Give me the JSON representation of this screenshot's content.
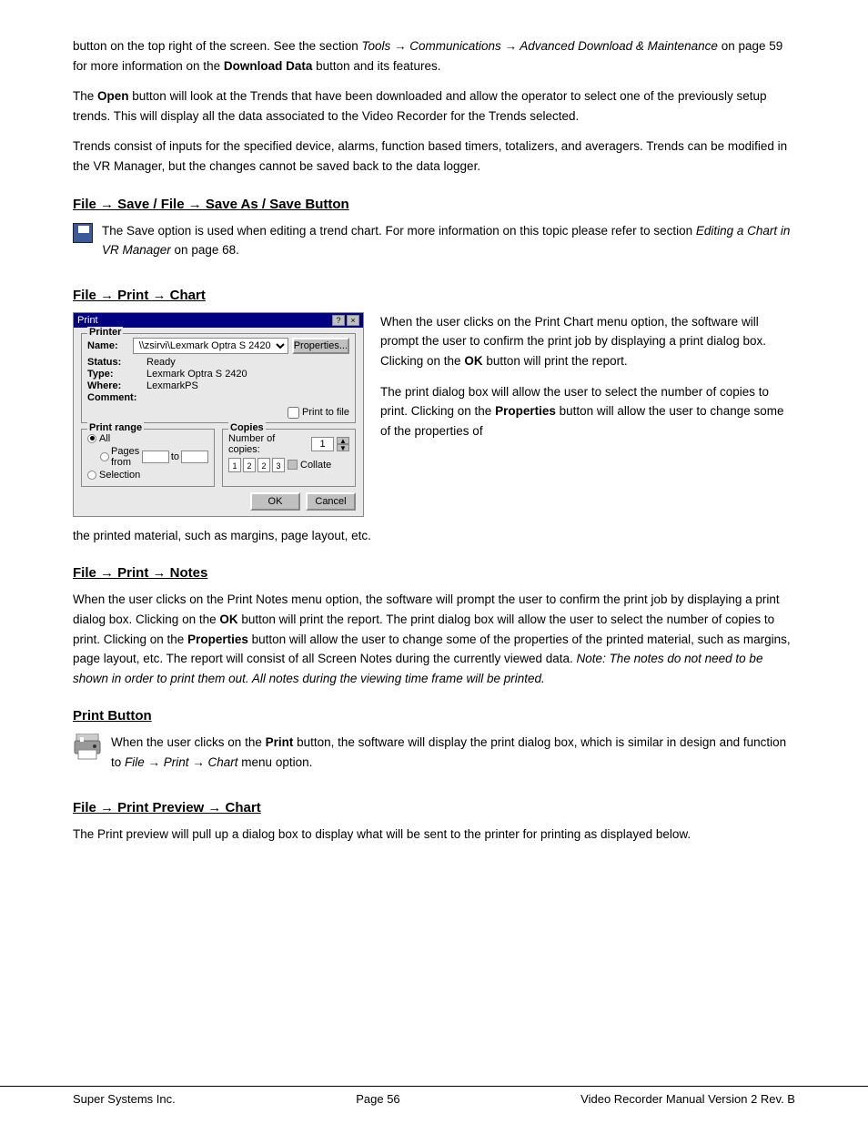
{
  "page": {
    "intro1": "button on the top right of the screen.  See the section ",
    "intro1_italic": "Tools → Communications → Advanced Download & Maintenance",
    "intro1b": " on page 59 for more information on the ",
    "intro1_bold": "Download Data",
    "intro1c": " button and its features.",
    "intro2_bold": "Open",
    "intro2": " button will look at the Trends that have been downloaded and allow the operator to select one of the previously setup trends.  This will display all the data associated to the Video Recorder for the Trends selected.",
    "intro3": "Trends consist of inputs for the specified device, alarms, function based timers, totalizers, and averagers. Trends can be modified in the VR Manager, but the changes cannot be saved back to the data logger."
  },
  "section_save": {
    "heading": "File → Save / File → Save As / Save Button",
    "body": "The Save option is used when editing a trend chart.  For more information on this topic please refer to section ",
    "body_italic": "Editing a Chart in VR Manager",
    "body2": " on page 68."
  },
  "section_print_chart": {
    "heading": "File → Print → Chart",
    "dialog": {
      "title": "Print",
      "title_btns": [
        "?",
        "×"
      ],
      "printer_group": "Printer",
      "name_label": "Name:",
      "name_value": "\\\\zsirvi\\Lexmark Optra S 2420",
      "properties_btn": "Properties...",
      "status_label": "Status:",
      "status_value": "Ready",
      "type_label": "Type:",
      "type_value": "Lexmark Optra S 2420",
      "where_label": "Where:",
      "where_value": "LexmarkPS",
      "comment_label": "Comment:",
      "print_to_file_label": "Print to file",
      "print_range_group": "Print range",
      "all_label": "All",
      "pages_label": "Pages  from",
      "to_label": "to",
      "selection_label": "Selection",
      "copies_group": "Copies",
      "num_copies_label": "Number of copies:",
      "num_copies_value": "1",
      "collate_nums": [
        "1",
        "2",
        "2",
        "3"
      ],
      "collate_label": "Collate",
      "ok_btn": "OK",
      "cancel_btn": "Cancel"
    },
    "side_text1": "When the user clicks on the Print Chart menu option, the software will prompt the user to confirm the print job by displaying a print dialog box.  Clicking on the ",
    "side_bold1": "OK",
    "side_text2": " button will print the report.",
    "side_text3": "The print dialog box will allow the user to select the number of copies to print. Clicking on the ",
    "side_bold2": "Properties",
    "side_text4": " button will allow the user to change some of the properties of",
    "caption": "the printed material, such as margins, page layout, etc."
  },
  "section_print_notes": {
    "heading": "File → Print → Notes",
    "body1": "When the user clicks on the Print Notes menu option, the software will prompt the user to confirm the print job by displaying a print dialog box.  Clicking on the ",
    "bold1": "OK",
    "body2": " button will print the report.  The print dialog box will allow the user to select the number of copies to print.  Clicking on the ",
    "bold2": "Properties",
    "body3": " button will allow the user to change some of the properties of the printed material, such as margins, page layout, etc.  The report will consist of all Screen Notes during the currently viewed data.  ",
    "italic1": "Note: The notes do not need to be shown in order to print them out.  All notes during the viewing time frame will be printed."
  },
  "section_print_button": {
    "heading": "Print Button",
    "body1": "When the user clicks on the ",
    "bold1": "Print",
    "body2": " button, the software will display the print dialog box, which is similar in design and function to ",
    "italic1": "File → Print → Chart",
    "body3": " menu option."
  },
  "section_print_preview": {
    "heading": "File → Print Preview → Chart",
    "body": "The Print preview will pull up a dialog box to display what will be sent to the printer for printing as displayed below."
  },
  "footer": {
    "left": "Super Systems Inc.",
    "center": "Page 56",
    "right": "Video Recorder Manual Version 2 Rev. B"
  }
}
